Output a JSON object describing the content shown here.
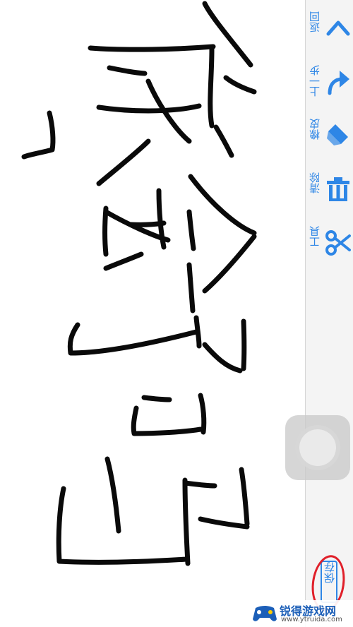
{
  "toolbar": {
    "items": [
      {
        "label": "返回",
        "icon": "chevron-up-icon"
      },
      {
        "label": "上一步",
        "icon": "undo-icon"
      },
      {
        "label": "橡皮",
        "icon": "eraser-icon"
      },
      {
        "label": "清除",
        "icon": "trash-icon"
      },
      {
        "label": "工具",
        "icon": "scissors-icon"
      }
    ],
    "save_label": "保存",
    "accent_color": "#2e86e6"
  },
  "highlight_color": "#e0202a",
  "watermark": {
    "title": "锐得游戏网",
    "url": "www.ytruida.com"
  }
}
